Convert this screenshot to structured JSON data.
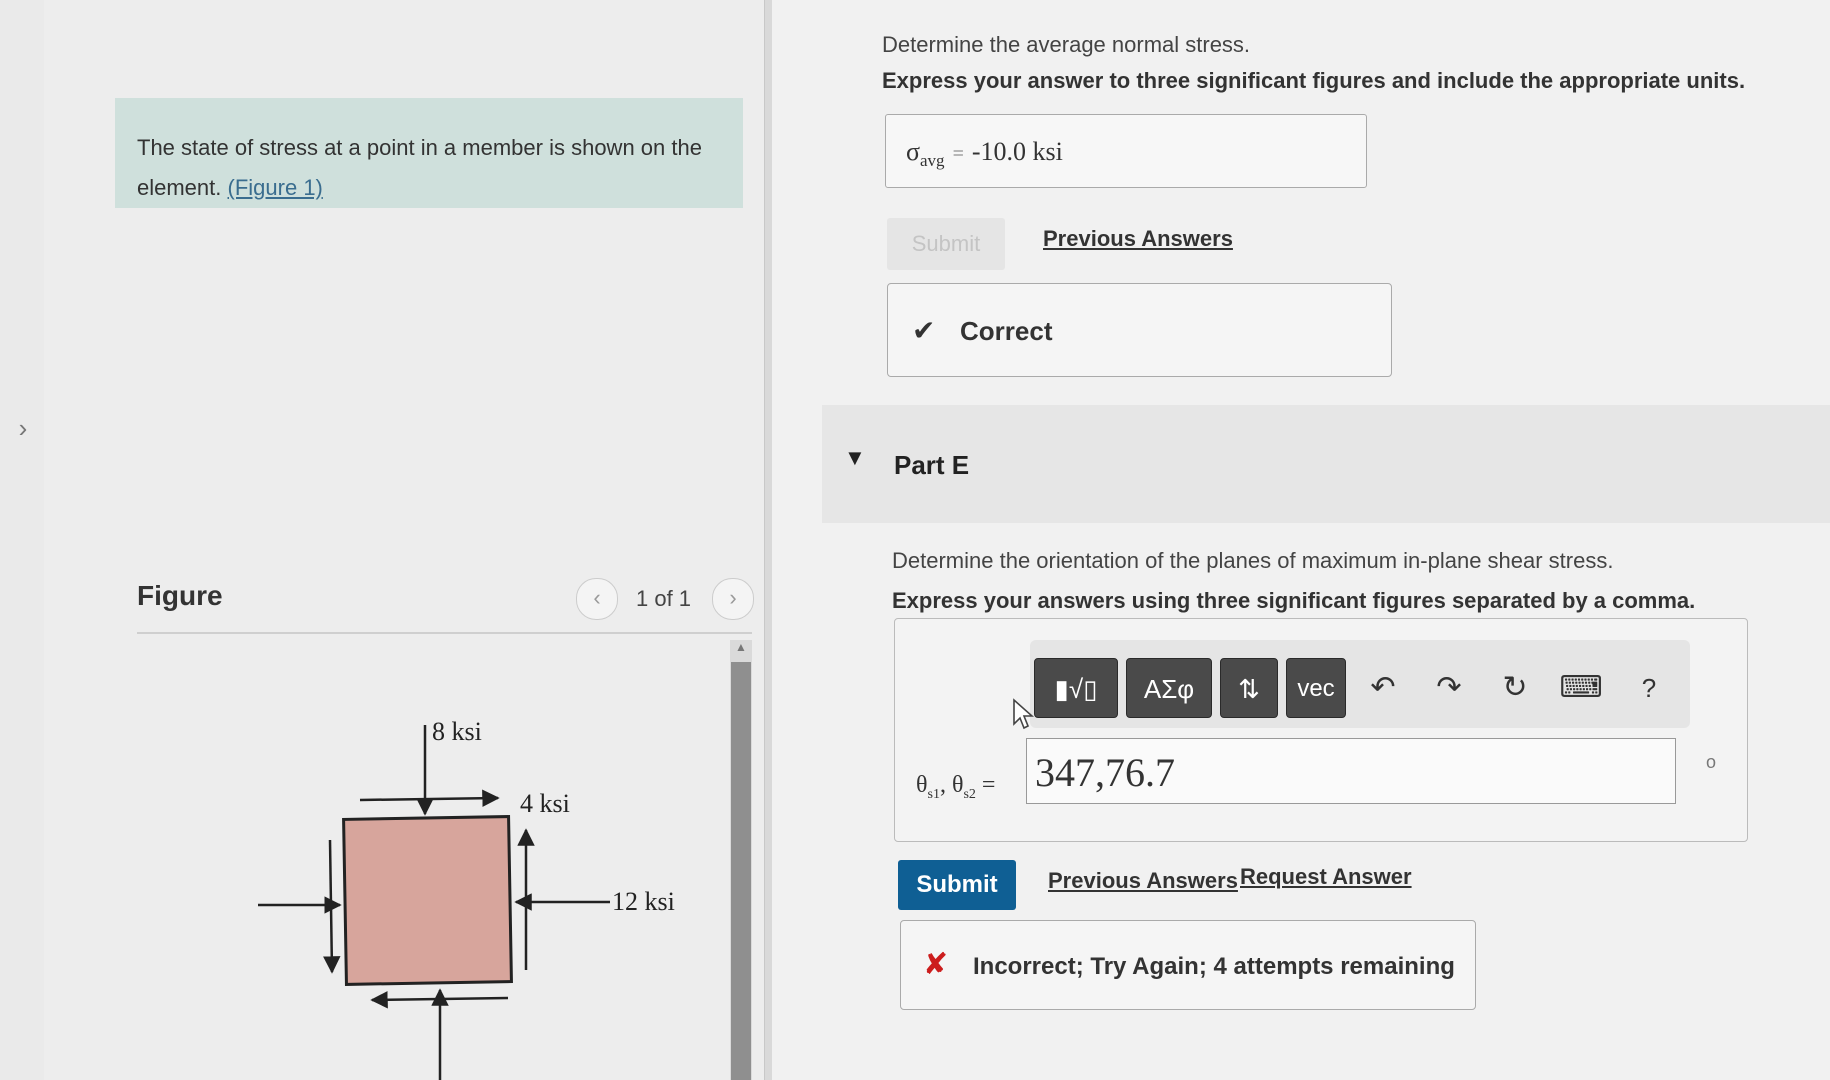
{
  "nav": {
    "expand_icon": "chevron-right-icon",
    "expand_glyph": "›"
  },
  "intro": {
    "text": "The state of stress at a point in a member is shown on the element.",
    "figure_link": "(Figure 1)"
  },
  "figure": {
    "label": "Figure",
    "pager": {
      "count": "1 of 1",
      "prev_glyph": "‹",
      "next_glyph": "›"
    },
    "scroll_up_glyph": "▲",
    "labels": {
      "top": "8 ksi",
      "shear": "4 ksi",
      "right": "12 ksi"
    },
    "colors": {
      "element_fill": "#d7a59c"
    }
  },
  "part_d": {
    "prompt": "Determine the average normal stress.",
    "instruction": "Express your answer to three significant figures and include the appropriate units.",
    "answer": {
      "symbol": "σ",
      "subscript": "avg",
      "equals": "=",
      "value": "-10.0 ksi"
    },
    "submit_label": "Submit",
    "previous_answers_link": "Previous Answers",
    "feedback": {
      "icon": "checkmark-icon",
      "glyph": "✔",
      "text": "Correct"
    }
  },
  "part_e": {
    "header": {
      "caret_glyph": "▼",
      "label": "Part E"
    },
    "prompt": "Determine the orientation of the planes of maximum in-plane shear stress.",
    "instruction": "Express your answers using three significant figures separated by a comma.",
    "toolbar": {
      "templates_label": "▮√▯",
      "symbols_label": "ΑΣφ",
      "arrows_label": "⇅",
      "vec_label": "vec",
      "undo_glyph": "↶",
      "redo_glyph": "↷",
      "reset_glyph": "↻",
      "keyboard_glyph": "⌨",
      "help_glyph": "?"
    },
    "variable": {
      "theta": "θ",
      "sub1": "s1",
      "sep": ",",
      "sub2": "s2",
      "equals": "="
    },
    "input_value": "347,76.7",
    "unit_mark": "o",
    "submit_label": "Submit",
    "previous_answers_link": "Previous Answers",
    "request_answer_link": "Request Answer",
    "feedback": {
      "icon": "x-icon",
      "glyph": "✘",
      "text": "Incorrect; Try Again; 4 attempts remaining"
    }
  },
  "colors": {
    "submit_blue": "#0f5f94",
    "intro_bg": "#cfe0dc",
    "error_red": "#cc1d1d"
  }
}
